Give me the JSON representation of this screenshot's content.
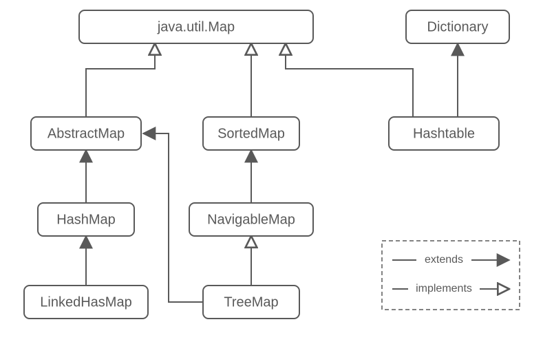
{
  "chart_data": {
    "type": "diagram",
    "title": "",
    "nodes": [
      {
        "id": "Map",
        "label": "java.util.Map"
      },
      {
        "id": "Dictionary",
        "label": "Dictionary"
      },
      {
        "id": "AbstractMap",
        "label": "AbstractMap"
      },
      {
        "id": "SortedMap",
        "label": "SortedMap"
      },
      {
        "id": "Hashtable",
        "label": "Hashtable"
      },
      {
        "id": "HashMap",
        "label": "HashMap"
      },
      {
        "id": "NavigableMap",
        "label": "NavigableMap"
      },
      {
        "id": "LinkedHasMap",
        "label": "LinkedHasMap"
      },
      {
        "id": "TreeMap",
        "label": "TreeMap"
      }
    ],
    "edges": [
      {
        "from": "AbstractMap",
        "to": "Map",
        "relation": "implements"
      },
      {
        "from": "SortedMap",
        "to": "Map",
        "relation": "implements"
      },
      {
        "from": "Hashtable",
        "to": "Map",
        "relation": "implements"
      },
      {
        "from": "Hashtable",
        "to": "Dictionary",
        "relation": "extends"
      },
      {
        "from": "HashMap",
        "to": "AbstractMap",
        "relation": "extends"
      },
      {
        "from": "LinkedHasMap",
        "to": "HashMap",
        "relation": "extends"
      },
      {
        "from": "NavigableMap",
        "to": "SortedMap",
        "relation": "extends"
      },
      {
        "from": "TreeMap",
        "to": "NavigableMap",
        "relation": "implements"
      },
      {
        "from": "TreeMap",
        "to": "AbstractMap",
        "relation": "extends"
      }
    ],
    "legend": {
      "extends_label": "extends",
      "implements_label": "implements"
    }
  }
}
